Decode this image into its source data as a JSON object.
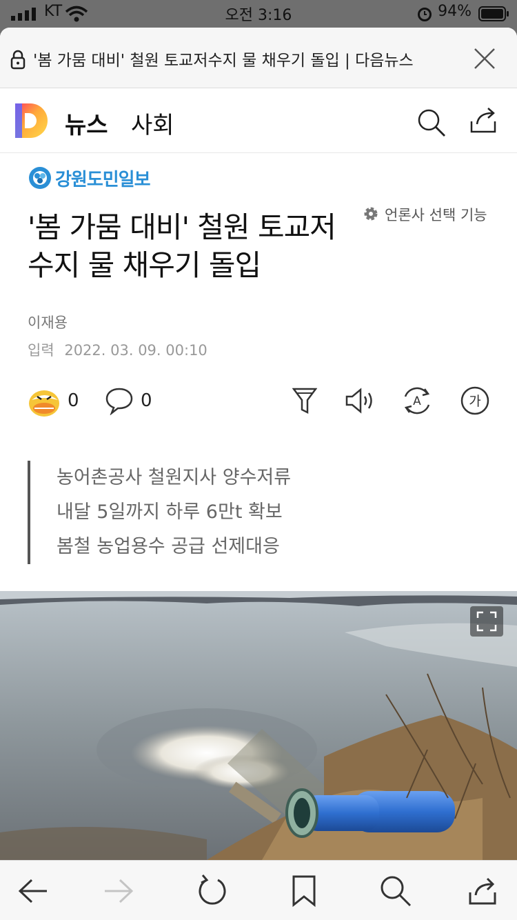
{
  "status_bar": {
    "carrier": "KT",
    "time": "오전 3:16",
    "battery": "94%"
  },
  "browser": {
    "url_title": "'봄 가뭄 대비' 철원 토교저수지 물 채우기 돌입 | 다음뉴스",
    "icons": [
      "lock-icon",
      "close-icon"
    ]
  },
  "header": {
    "section_news": "뉴스",
    "section_category": "사회",
    "icons": [
      "daum-logo",
      "search-icon",
      "share-icon"
    ]
  },
  "article": {
    "press_name": "강원도민일보",
    "press_select_label": "언론사 선택 기능",
    "title": "'봄 가뭄 대비' 철원 토교저수지 물 채우기 돌입",
    "author": "이재용",
    "date_label": "입력",
    "date_value": "2022. 03. 09. 00:10",
    "reaction_count": "0",
    "comment_count": "0",
    "summary": [
      "농어촌공사 철원지사 양수저류",
      "내달 5일까지 하루 6만t 확보",
      "봄철 농업용수 공급 선제대응"
    ],
    "tool_icons": [
      "filter-icon",
      "speaker-icon",
      "translate-icon",
      "font-size-icon"
    ],
    "font_icon_label": "가",
    "translate_icon_label": "A"
  },
  "bottom_nav": [
    "back-icon",
    "forward-icon",
    "reload-icon",
    "bookmark-icon",
    "search-icon",
    "share-icon"
  ],
  "colors": {
    "press_blue": "#2a8fd6",
    "pipe_blue": "#2f6fd0"
  }
}
